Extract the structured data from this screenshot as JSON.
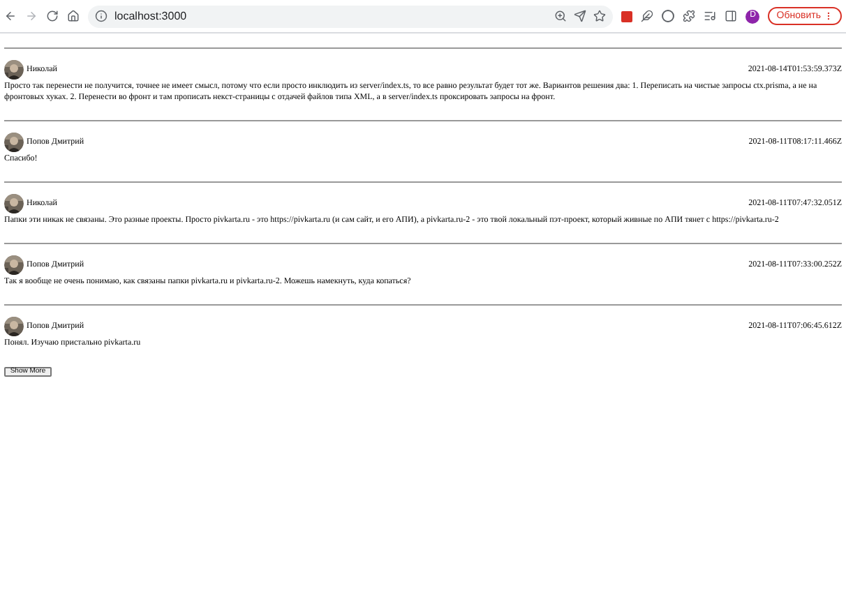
{
  "browser": {
    "url": "localhost:3000",
    "update_button": "Обновить",
    "profile_initial": "D"
  },
  "comments": [
    {
      "author": "Николай",
      "timestamp": "2021-08-14T01:53:59.373Z",
      "text": "Просто так перенести не получится, точнее не имеет смысл, потому что если просто инклюдить из server/index.ts, то все равно результат будет тот же. Вариантов решения два: 1. Переписать на чистые запросы ctx.prisma, а не на фронтовых хуках. 2. Перенести во фронт и там прописать некст-страницы с отдачей файлов типа XML, а в server/index.ts проксировать запросы на фронт."
    },
    {
      "author": "Попов Дмитрий",
      "timestamp": "2021-08-11T08:17:11.466Z",
      "text": "Спасибо!"
    },
    {
      "author": "Николай",
      "timestamp": "2021-08-11T07:47:32.051Z",
      "text": "Папки эти никак не связаны. Это разные проекты. Просто pivkarta.ru - это https://pivkarta.ru (и сам сайт, и его АПИ), а pivkarta.ru-2 - это твой локальный пэт-проект, который живные по АПИ тянет с https://pivkarta.ru-2"
    },
    {
      "author": "Попов Дмитрий",
      "timestamp": "2021-08-11T07:33:00.252Z",
      "text": "Так я вообще не очень понимаю, как связаны папки pivkarta.ru и pivkarta.ru-2. Можешь намекнуть, куда копаться?"
    },
    {
      "author": "Попов Дмитрий",
      "timestamp": "2021-08-11T07:06:45.612Z",
      "text": "Понял. Изучаю пристально pivkarta.ru"
    }
  ],
  "show_more_button": "Show More"
}
